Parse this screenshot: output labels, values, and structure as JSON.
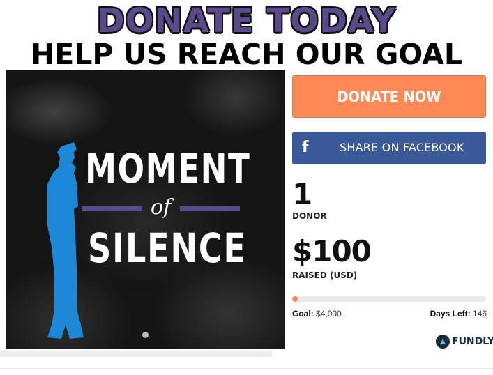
{
  "header": {
    "title": "DONATE TODAY",
    "subtitle": "HELP US REACH OUR GOAL"
  },
  "campaign_image": {
    "title_top": "MOMENT",
    "title_mid": "of",
    "title_bottom": "SILENCE",
    "carousel_dots": 1
  },
  "actions": {
    "donate_label": "DONATE NOW",
    "share_label": "SHARE ON FACEBOOK",
    "facebook_glyph": "f"
  },
  "stats": {
    "donor_count": "1",
    "donor_label": "DONOR",
    "raised_amount": "$100",
    "raised_label": "RAISED (USD)",
    "progress_fraction": 0.025,
    "goal_label": "Goal:",
    "goal_value": "$4,000",
    "days_label": "Days Left:",
    "days_value": "146"
  },
  "branding": {
    "logo_text": "FUNDLY"
  },
  "colors": {
    "accent_orange": "#ff8a57",
    "facebook_blue": "#3b5998",
    "brand_purple": "#5b4a8b",
    "silhouette_blue": "#1e88d8"
  }
}
